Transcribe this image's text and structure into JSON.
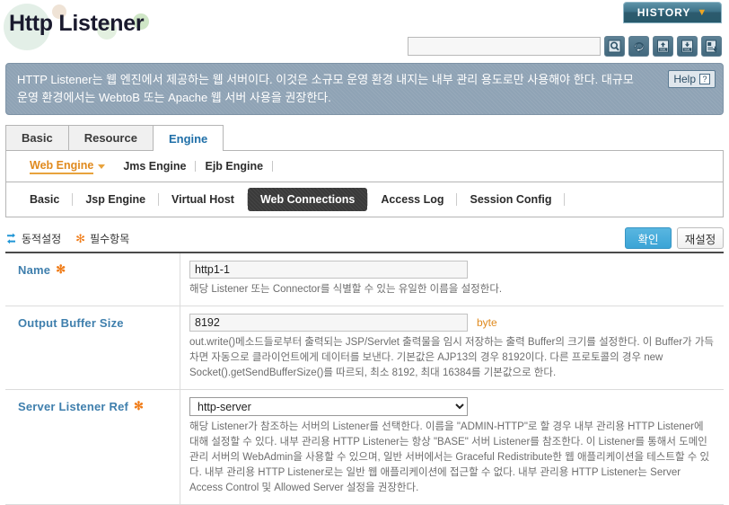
{
  "header": {
    "title": "Http Listener",
    "history_label": "HISTORY",
    "history_caret": "▼",
    "search_placeholder": "",
    "search_value": "",
    "toolbar_icons": [
      {
        "name": "search-icon",
        "label": "Search"
      },
      {
        "name": "refresh-icon",
        "label": "Refresh"
      },
      {
        "name": "xml-import-icon",
        "label": "XML Import"
      },
      {
        "name": "xml-export-icon",
        "label": "XML Export"
      },
      {
        "name": "report-export-icon",
        "label": "Report Export"
      }
    ]
  },
  "info": {
    "text": "HTTP Listener는 웹 엔진에서 제공하는 웹 서버이다. 이것은 소규모 운영 환경 내지는 내부 관리 용도로만 사용해야 한다. 대규모 운영 환경에서는 WebtoB 또는 Apache 웹 서버 사용을 권장한다.",
    "help_label": "Help",
    "help_glyph": "?"
  },
  "main_tabs": [
    {
      "label": "Basic",
      "active": false
    },
    {
      "label": "Resource",
      "active": false
    },
    {
      "label": "Engine",
      "active": true
    }
  ],
  "engine_tabs": [
    {
      "label": "Web Engine",
      "active": true
    },
    {
      "label": "Jms Engine",
      "active": false
    },
    {
      "label": "Ejb Engine",
      "active": false
    }
  ],
  "sub_tabs": [
    {
      "label": "Basic",
      "active": false
    },
    {
      "label": "Jsp Engine",
      "active": false
    },
    {
      "label": "Virtual Host",
      "active": false
    },
    {
      "label": "Web Connections",
      "active": true
    },
    {
      "label": "Access Log",
      "active": false
    },
    {
      "label": "Session Config",
      "active": false
    }
  ],
  "action_bar": {
    "dynamic_label": "동적설정",
    "required_label": "필수항목",
    "required_star": "✻",
    "confirm_label": "확인",
    "reset_label": "재설정"
  },
  "form": {
    "rows": [
      {
        "label": "Name",
        "required": true,
        "required_star": "✻",
        "control": "text",
        "value": "http1-1",
        "unit": "",
        "desc": "해당 Listener 또는 Connector를 식별할 수 있는 유일한 이름을 설정한다."
      },
      {
        "label": "Output Buffer Size",
        "required": false,
        "required_star": "",
        "control": "text",
        "value": "8192",
        "unit": "byte",
        "desc": "out.write()메소드들로부터 출력되는 JSP/Servlet 출력물을 임시 저장하는 출력 Buffer의 크기를 설정한다. 이 Buffer가 가득 차면 자동으로 클라이언트에게 데이터를 보낸다. 기본값은 AJP13의 경우 8192이다. 다른 프로토콜의 경우 new Socket().getSendBufferSize()를 따르되, 최소 8192, 최대 16384를 기본값으로 한다."
      },
      {
        "label": "Server Listener Ref",
        "required": true,
        "required_star": "✻",
        "control": "select",
        "value": "http-server",
        "options": [
          "http-server"
        ],
        "unit": "",
        "desc": "해당 Listener가 참조하는 서버의 Listener를 선택한다. 이름을 \"ADMIN-HTTP\"로 할 경우 내부 관리용 HTTP Listener에 대해 설정할 수 있다. 내부 관리용 HTTP Listener는 항상 \"BASE\" 서버 Listener를 참조한다. 이 Listener를 통해서 도메인 관리 서버의 WebAdmin을 사용할 수 있으며, 일반 서버에서는 Graceful Redistribute한 웹 애플리케이션을 테스트할 수 있다. 내부 관리용 HTTP Listener로는 일반 웹 애플리케이션에 접근할 수 없다. 내부 관리용 HTTP Listener는 Server Access Control 및 Allowed Server 설정을 권장한다."
      }
    ]
  },
  "colors": {
    "accent_blue": "#3ba4d6",
    "label_blue": "#3f7fad",
    "accent_orange": "#e08a1e",
    "banner_gray": "#8fa3b5",
    "active_tab_dark": "#3a3a3a",
    "history_teal": "#3d7288"
  }
}
